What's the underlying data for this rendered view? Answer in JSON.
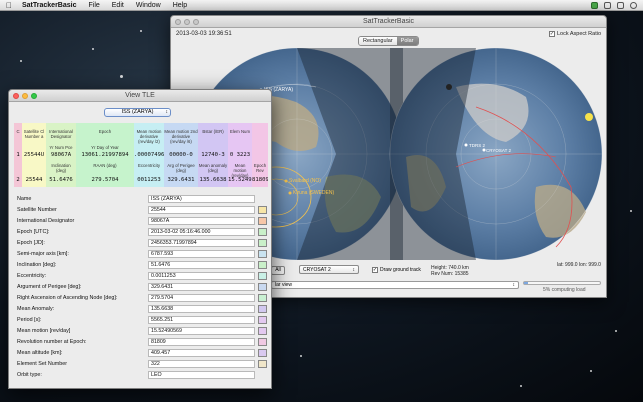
{
  "menubar": {
    "app_name": "SatTrackerBasic",
    "items": [
      "File",
      "Edit",
      "Window",
      "Help"
    ]
  },
  "main_window": {
    "title": "SatTrackerBasic",
    "datetime": "2013-03-03   19:36:51",
    "projection_tabs": [
      {
        "label": "Rectangular",
        "active": false
      },
      {
        "label": "Polar",
        "active": true
      }
    ],
    "lock_aspect_label": "Lock Aspect Ratio",
    "lock_aspect_checked": true,
    "map_labels": {
      "iss": "ISS (ZARYA)",
      "svalbard": "Svalbard (NO)",
      "kiruna": "Kiruna (SWEDEN)",
      "tdrs": "TDRS 2",
      "cryosat": "CRYOSAT 2"
    },
    "all_button": "All",
    "satellite_select": "CRYOSAT 2",
    "draw_ground_track_label": "Draw ground track",
    "draw_ground_track_checked": true,
    "height_info": "Height: 740.0 km",
    "rev_info": "Rev Num: 15385",
    "coords": "lat: 999.0   lon: 999.0",
    "view_select": "lar view",
    "computing_status": "5% computing load"
  },
  "tle_window": {
    "title": "View TLE",
    "selected_satellite": "ISS (ZARYA)",
    "columns": [
      {
        "header": "C",
        "sub": "",
        "line1": "1",
        "header2": "",
        "line2": "2",
        "color": "#f4c6d6"
      },
      {
        "header": "Satellite Cl Number a",
        "sub": "",
        "line1": "25544U",
        "header2": "",
        "line2": "25544",
        "color": "#f8f8c6"
      },
      {
        "header": "International Designator",
        "sub": "Yr Num  Pce",
        "line1": "98067A",
        "header2": "Inclination (deg)",
        "line2": "51.6476",
        "color": "#d9f3c6"
      },
      {
        "header": "Epoch",
        "sub": "Yr   Day of Year",
        "line1": "13061.21997894",
        "header2": "RAAN (deg)",
        "line2": "279.5704",
        "color": "#c6f3cc"
      },
      {
        "header": "Mean motion derivative (rev/day /2)",
        "sub": "",
        "line1": ".00007496",
        "header2": "Eccentricity",
        "line2": "0011253",
        "color": "#c6eef3"
      },
      {
        "header": "Mean motion 2nd derivative (rev/day /6)",
        "sub": "",
        "line1": "00000-0",
        "header2": "Arg of Perigee (deg)",
        "line2": "329.6431",
        "color": "#c6d9f3"
      },
      {
        "header": "Bstar (/ER)",
        "sub": "",
        "line1": "12740-3",
        "header2": "Mean anomaly (deg)",
        "line2": "135.6638",
        "color": "#d2c6f3"
      },
      {
        "header": "Elem Num",
        "sub": "",
        "line1": "0  3223",
        "header2": "Mean motion (rev/day)",
        "line2": "15.52490569",
        "color": "#e6c6f3"
      },
      {
        "header": "",
        "sub": "",
        "line1": "",
        "header2": "Epoch Rev",
        "line2": "818099",
        "color": "#f3c6e6"
      }
    ],
    "rows": [
      {
        "label": "Name",
        "value": "ISS (ZARYA)",
        "swatch": ""
      },
      {
        "label": "Satellite Number",
        "value": "25544",
        "swatch": "#f7e6a8"
      },
      {
        "label": "International Designator",
        "value": "98067A",
        "swatch": "#f7c7a8"
      },
      {
        "label": "Epoch [UTC]:",
        "value": "2013-03-02   05:16:46.000",
        "swatch": "#c9f0c9"
      },
      {
        "label": "Epoch [JD]:",
        "value": "2456353.71997894",
        "swatch": "#c9f0c9"
      },
      {
        "label": "Semi-major axis [km]:",
        "value": "6787.593",
        "swatch": "#c9e3f0"
      },
      {
        "label": "Inclination [deg]:",
        "value": "51.6476",
        "swatch": "#c9f0c9"
      },
      {
        "label": "Eccentricity:",
        "value": "0.0011253",
        "swatch": "#c9f0e6"
      },
      {
        "label": "Argument of Perigee [deg]:",
        "value": "329.6431",
        "swatch": "#c9d9f0"
      },
      {
        "label": "Right Ascension of Ascending Node [deg]:",
        "value": "279.5704",
        "swatch": "#c9f0d2"
      },
      {
        "label": "Mean Anomaly:",
        "value": "135.6638",
        "swatch": "#d2c9f0"
      },
      {
        "label": "Period [s]:",
        "value": "5565.251",
        "swatch": "#e3c9f0"
      },
      {
        "label": "Mean motion [rev/day]",
        "value": "15.52490569",
        "swatch": "#e3c9f0"
      },
      {
        "label": "Revolution number at Epoch:",
        "value": "81809",
        "swatch": "#f0c9e3"
      },
      {
        "label": "Mean altitude [km]:",
        "value": "409.457",
        "swatch": "#d9c9f0"
      },
      {
        "label": "Element Set Number",
        "value": "322",
        "swatch": "#f0e6c9"
      },
      {
        "label": "Orbit type:",
        "value": "LEO",
        "swatch": ""
      }
    ]
  }
}
